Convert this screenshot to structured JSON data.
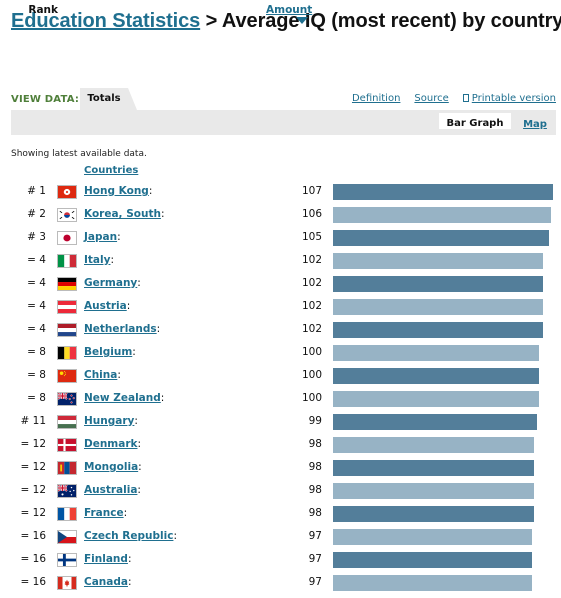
{
  "header": {
    "breadcrumb_link": "Education Statistics",
    "separator": " > ",
    "title": "Average IQ (most recent) by country"
  },
  "view": {
    "label": "VIEW DATA:",
    "active_tab": "Totals",
    "links": {
      "definition": "Definition",
      "source": "Source",
      "printable": "Printable version"
    },
    "subtabs": {
      "bar_graph": "Bar Graph",
      "map": "Map"
    }
  },
  "table": {
    "note": "Showing latest available data.",
    "headers": {
      "rank": "Rank",
      "countries": "Countries",
      "amount": "Amount"
    },
    "max_value": 107,
    "bar_colors": {
      "dark": "#537e9a",
      "light": "#97b3c5"
    },
    "rows": [
      {
        "rank": "# 1",
        "country": "Hong Kong",
        "value": 107,
        "flag": "hong-kong"
      },
      {
        "rank": "# 2",
        "country": "Korea, South",
        "value": 106,
        "flag": "south-korea"
      },
      {
        "rank": "# 3",
        "country": "Japan",
        "value": 105,
        "flag": "japan"
      },
      {
        "rank": "= 4",
        "country": "Italy",
        "value": 102,
        "flag": "italy"
      },
      {
        "rank": "= 4",
        "country": "Germany",
        "value": 102,
        "flag": "germany"
      },
      {
        "rank": "= 4",
        "country": "Austria",
        "value": 102,
        "flag": "austria"
      },
      {
        "rank": "= 4",
        "country": "Netherlands",
        "value": 102,
        "flag": "netherlands"
      },
      {
        "rank": "= 8",
        "country": "Belgium",
        "value": 100,
        "flag": "belgium"
      },
      {
        "rank": "= 8",
        "country": "China",
        "value": 100,
        "flag": "china"
      },
      {
        "rank": "= 8",
        "country": "New Zealand",
        "value": 100,
        "flag": "new-zealand"
      },
      {
        "rank": "# 11",
        "country": "Hungary",
        "value": 99,
        "flag": "hungary"
      },
      {
        "rank": "= 12",
        "country": "Denmark",
        "value": 98,
        "flag": "denmark"
      },
      {
        "rank": "= 12",
        "country": "Mongolia",
        "value": 98,
        "flag": "mongolia"
      },
      {
        "rank": "= 12",
        "country": "Australia",
        "value": 98,
        "flag": "australia"
      },
      {
        "rank": "= 12",
        "country": "France",
        "value": 98,
        "flag": "france"
      },
      {
        "rank": "= 16",
        "country": "Czech Republic",
        "value": 97,
        "flag": "czech-republic"
      },
      {
        "rank": "= 16",
        "country": "Finland",
        "value": 97,
        "flag": "finland"
      },
      {
        "rank": "= 16",
        "country": "Canada",
        "value": 97,
        "flag": "canada"
      }
    ]
  }
}
